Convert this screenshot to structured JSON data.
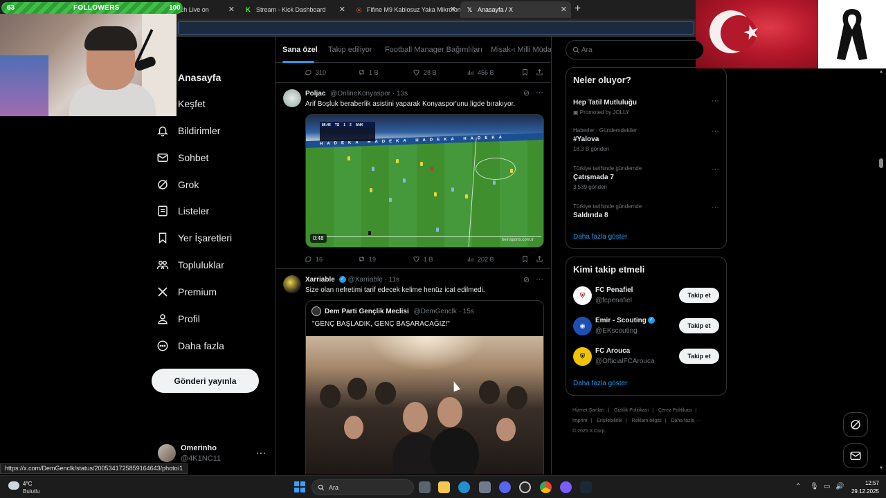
{
  "browser": {
    "tabs": [
      {
        "label": "omerinho Watch Live on",
        "icon": "kick-icon",
        "color": "#53fc18"
      },
      {
        "label": "Stream - Kick Dashboard",
        "icon": "kick-icon",
        "color": "#53fc18"
      },
      {
        "label": "Fifine M9 Kablosuz Yaka Mikrofon",
        "icon": "shop-icon",
        "color": "#f06a2a"
      },
      {
        "label": "Anasayfa / X",
        "icon": "x-logo-icon",
        "color": "#ffffff"
      }
    ],
    "status_url": "https://x.com/DemGenclk/status/2005341725859164643/photo/1"
  },
  "overlay": {
    "followers_label": "FOLLOWERS",
    "followers_count": "63",
    "followers_goal": "100"
  },
  "nav": {
    "items": [
      {
        "label": "Anasayfa",
        "icon": "home-icon"
      },
      {
        "label": "Keşfet",
        "icon": "search-icon"
      },
      {
        "label": "Bildirimler",
        "icon": "bell-icon"
      },
      {
        "label": "Sohbet",
        "icon": "mail-icon"
      },
      {
        "label": "Grok",
        "icon": "grok-icon"
      },
      {
        "label": "Listeler",
        "icon": "list-icon"
      },
      {
        "label": "Yer İşaretleri",
        "icon": "bookmark-icon"
      },
      {
        "label": "Topluluklar",
        "icon": "communities-icon"
      },
      {
        "label": "Premium",
        "icon": "x-logo-icon"
      },
      {
        "label": "Profil",
        "icon": "profile-icon"
      },
      {
        "label": "Daha fazla",
        "icon": "more-circle-icon"
      }
    ],
    "post_button": "Gönderi yayınla",
    "account": {
      "name": "Omerinho",
      "handle": "@4K1NC11",
      "more": "···"
    }
  },
  "feed": {
    "tabs": [
      "Sana özel",
      "Takip ediliyor",
      "Football Manager Bağımlıları",
      "Misak-ı Milli Müdaf"
    ],
    "first_actions": {
      "replies": "310",
      "reposts": "1 B",
      "likes": "28 B",
      "views": "456 B"
    },
    "tweets": [
      {
        "name": "Poljac",
        "handle": "@OnlineKonyaspor",
        "time": "13s",
        "text": "Arif Boşluk beraberlik asistini yaparak Konyaspor'unu ligde bırakıyor.",
        "video_duration": "0:48",
        "watermark": "beinsports.com.tr",
        "score": {
          "home": "TS",
          "home_goals": "1",
          "away_goals": "2",
          "away": "ANK",
          "clock": "86:46"
        },
        "actions": {
          "replies": "16",
          "reposts": "19",
          "likes": "1 B",
          "views": "202 B"
        }
      },
      {
        "name": "Xarriable",
        "handle": "@Xarriable",
        "time": "11s",
        "text": "Size olan nefretimi tarif edecek kelime henüz icat edilmedi.",
        "quote": {
          "name": "Dem Parti Gençlik Meclisi",
          "handle": "@DemGenclk",
          "time": "15s",
          "text": "\"GENÇ BAŞLADIK, GENÇ BAŞARACAĞIZ!\""
        }
      }
    ]
  },
  "sidebar": {
    "search_placeholder": "Ara",
    "trends_title": "Neler oluyor?",
    "trends": [
      {
        "context": "",
        "title": "Hep Tatil Mutluluğu",
        "count": "Promoted by JOLLY"
      },
      {
        "context": "Haberler · Gündemdekiler",
        "title": "#Yalova",
        "count": "18,3 B gönderi"
      },
      {
        "context": "Türkiye tarihinde gündemde",
        "title": "Çatışmada 7",
        "count": "3.539 gönderi"
      },
      {
        "context": "Türkiye tarihinde gündemde",
        "title": "Saldırıda 8",
        "count": ""
      }
    ],
    "show_more": "Daha fazla göster",
    "who_title": "Kimi takip etmeli",
    "who": [
      {
        "name": "FC Penafiel",
        "handle": "@fcpenafiel",
        "verified": false,
        "badge": "FCP",
        "color": "#b8262c"
      },
      {
        "name": "Emir - Scouting",
        "handle": "@EKscouting",
        "verified": true,
        "badge": "EK",
        "color": "#1e4fb3"
      },
      {
        "name": "FC Arouca",
        "handle": "@OfficialFCArouca",
        "verified": false,
        "badge": "FCA",
        "color": "#f1c400"
      }
    ],
    "follow_label": "Takip et",
    "footer": [
      "Hizmet Şartları",
      "|",
      "Gizlilik Politikası",
      "|",
      "Çerez Politikası",
      "|",
      "Imprint",
      "|",
      "Erişilebilirlik",
      "|",
      "Reklam bilgisi",
      "|",
      "Daha fazla ···",
      "© 2025 X Corp."
    ]
  },
  "taskbar": {
    "temp": "4°C",
    "condition": "Bulutlu",
    "search": "Ara",
    "time": "12:57",
    "date": "29.12.2025"
  }
}
